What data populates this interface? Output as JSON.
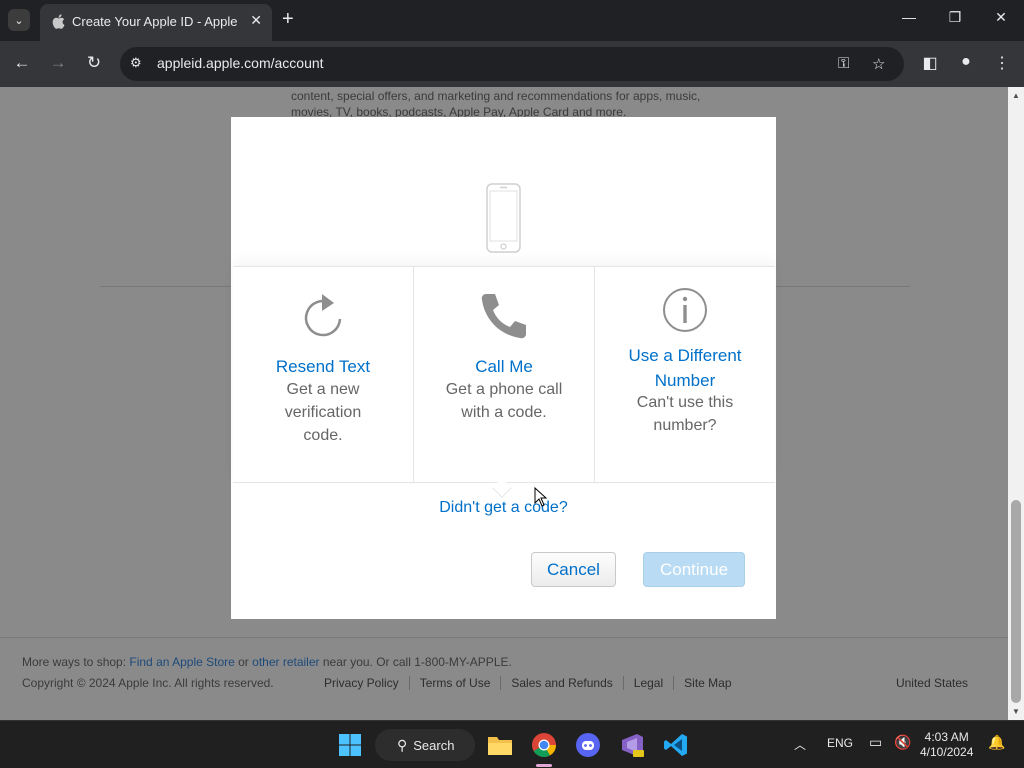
{
  "browser": {
    "tab_title": "Create Your Apple ID - Apple",
    "url": "appleid.apple.com/account"
  },
  "page": {
    "bg_text": "content, special offers, and marketing and recommendations for apps, music, movies, TV, books, podcasts, Apple Pay, Apple Card and more.",
    "footer": {
      "shop_prefix": "More ways to shop: ",
      "find_store": "Find an Apple Store",
      "or": " or ",
      "other_retailer": "other retailer",
      "shop_suffix": " near you. Or call 1-800-MY-APPLE.",
      "copyright": "Copyright © 2024 Apple Inc. All rights reserved.",
      "links": [
        "Privacy Policy",
        "Terms of Use",
        "Sales and Refunds",
        "Legal",
        "Site Map"
      ],
      "country": "United States"
    }
  },
  "modal": {
    "options": [
      {
        "title": "Resend Text",
        "desc": "Get a new verification code.",
        "icon": "refresh-icon"
      },
      {
        "title": "Call Me",
        "desc": "Get a phone call with a code.",
        "icon": "phone-call-icon"
      },
      {
        "title": "Use a Different Number",
        "desc": "Can't use this number?",
        "icon": "info-icon"
      }
    ],
    "didnt_get_code": "Didn't get a code?",
    "cancel": "Cancel",
    "continue": "Continue"
  },
  "taskbar": {
    "search": "Search",
    "lang": "ENG",
    "time": "4:03 AM",
    "date": "4/10/2024"
  }
}
